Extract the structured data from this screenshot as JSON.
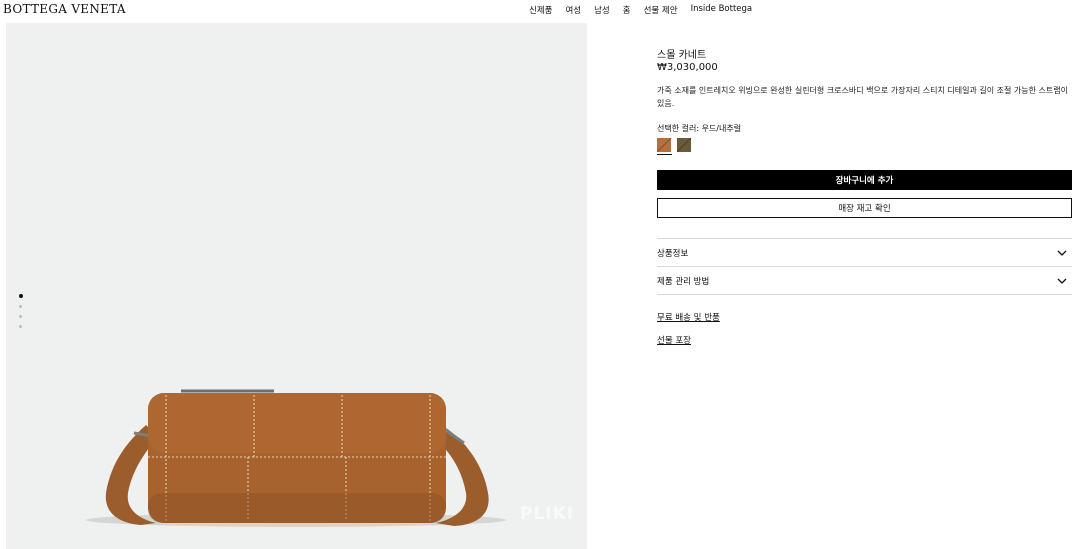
{
  "header": {
    "logo": "BOTTEGA VENETA",
    "nav": [
      "신제품",
      "여성",
      "남성",
      "홈",
      "선물 제안",
      "Inside Bottega"
    ]
  },
  "gallery": {
    "watermark": "PLIKI",
    "slides_count": 4,
    "active_slide": 1
  },
  "product": {
    "name": "스몰 카네트",
    "price": "₩3,030,000",
    "description": "가죽 소재를 인트레치오 위빙으로 완성한 실린더형 크로스바디 백으로 가장자리 스티치 디테일과 길이 조절 가능한 스트랩이 있음.",
    "color_label": "선택한 컬러: 우드/내추럴",
    "swatches": [
      {
        "name": "wood",
        "color": "#b5703b",
        "selected": true
      },
      {
        "name": "dark",
        "color": "#6b5a3a",
        "selected": false
      }
    ],
    "add_to_cart": "장바구니에 추가",
    "check_stock": "매장 재고 확인",
    "accordions": [
      "상품정보",
      "제품 관리 방법"
    ],
    "links": [
      "무료 배송 및 반품",
      "선물 포장"
    ]
  }
}
